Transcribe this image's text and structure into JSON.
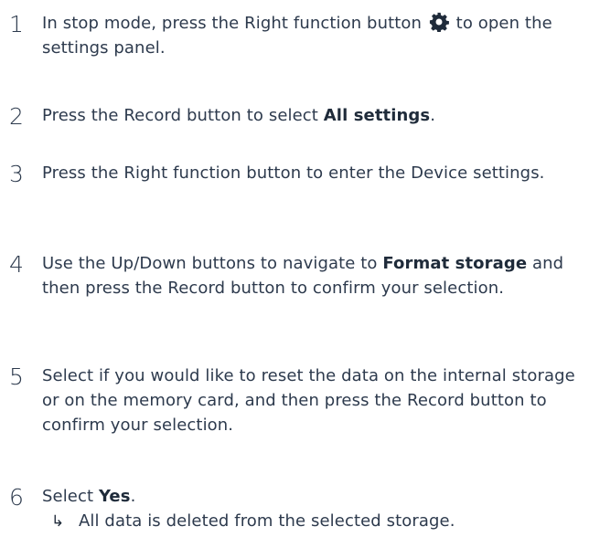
{
  "steps": [
    {
      "number": "1",
      "text_before": "In stop mode, press the Right function button",
      "icon": "gear-icon",
      "text_after": "to open the settings panel."
    },
    {
      "number": "2",
      "text_before": "Press the Record button to select ",
      "bold": "All settings",
      "text_after": "."
    },
    {
      "number": "3",
      "text": "Press the Right function button to enter the Device settings."
    },
    {
      "number": "4",
      "text_before": "Use the Up/Down buttons to navigate to ",
      "bold": "Format storage",
      "text_after": " and then press the Record button to confirm your selection."
    },
    {
      "number": "5",
      "text": "Select if you would like to reset the data on the internal storage or on the memory card, and then press the Record button to confirm your selection."
    },
    {
      "number": "6",
      "text_before": "Select ",
      "bold": "Yes",
      "text_after": ".",
      "result_arrow": "↳",
      "result": "All data is deleted from the selected storage."
    }
  ]
}
